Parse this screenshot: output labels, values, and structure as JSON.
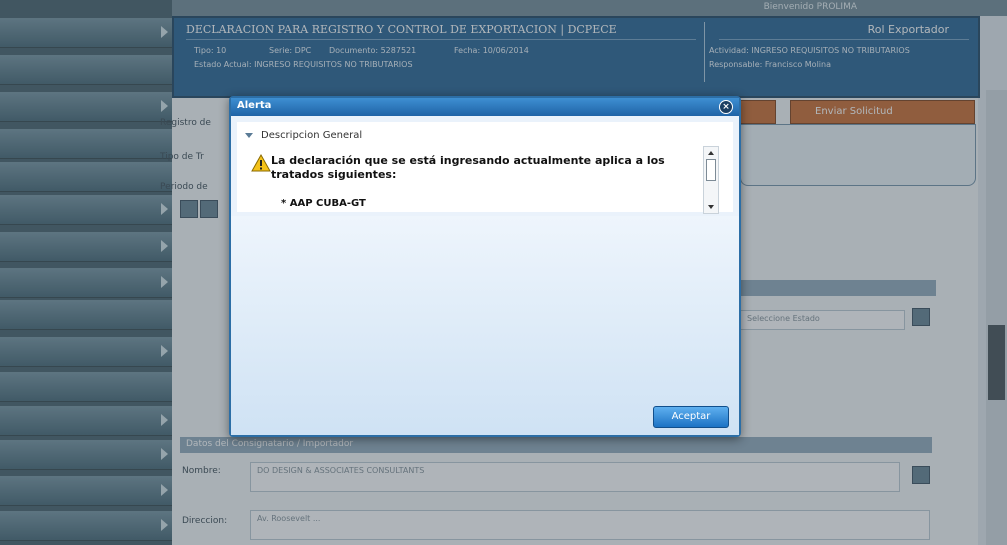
{
  "header": {
    "representative": "Bienvenido PROLIMA",
    "form_title": "DECLARACION PARA REGISTRO Y CONTROL DE EXPORTACION | DCPECE",
    "role": "Rol Exportador",
    "tipo": "Tipo: 10",
    "serie": "Serie: DPC",
    "documento": "Documento: 5287521",
    "fecha": "Fecha: 10/06/2014",
    "estado": "Estado Actual: INGRESO REQUISITOS NO TRIBUTARIOS",
    "actividad": "Actividad: INGRESO REQUISITOS NO TRIBUTARIOS",
    "responsable": "Responsable: Francisco Molina"
  },
  "toolbar": {
    "send_request": "Enviar Solicitud"
  },
  "background": {
    "section_destinatario": "Datos del Consignatario / Importador",
    "nombre_label": "Nombre:",
    "direccion_label": "Direccion:",
    "nombre_value": "DO DESIGN & ASSOCIATES CONSULTANTS",
    "direccion_value": "Av. Roosevelt ...",
    "select_label": "Seleccione Estado",
    "registro_label": "Registro de",
    "tipo_label": "Tipo de Tr",
    "periodo_label": "Periodo de"
  },
  "modal": {
    "title": "Alerta",
    "close_symbol": "×",
    "section_title": "Descripcion General",
    "message": "La declaración que se está ingresando actualmente aplica a los tratados siguientes:",
    "treaty": "* AAP CUBA-GT",
    "accept_label": "Aceptar"
  }
}
